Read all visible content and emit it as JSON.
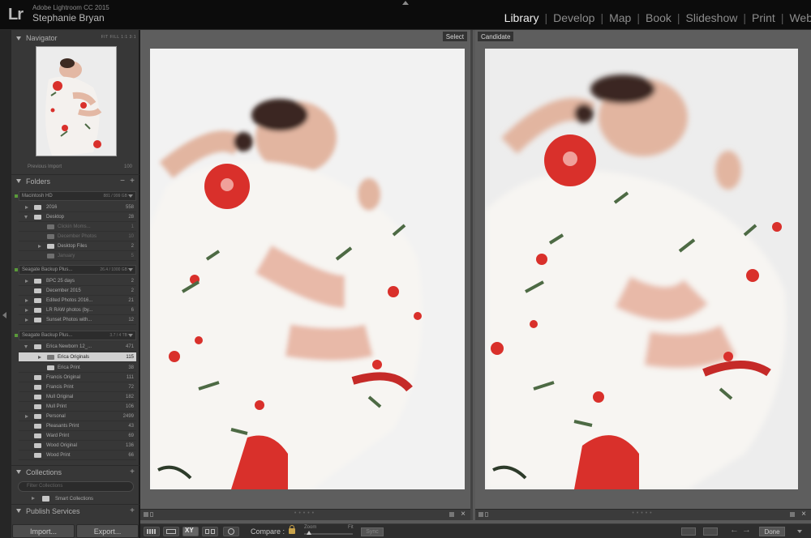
{
  "app": {
    "logo": "Lr",
    "product": "Adobe Lightroom CC 2015",
    "user": "Stephanie Bryan"
  },
  "modules": [
    {
      "label": "Library",
      "active": true
    },
    {
      "label": "Develop",
      "active": false
    },
    {
      "label": "Map",
      "active": false
    },
    {
      "label": "Book",
      "active": false
    },
    {
      "label": "Slideshow",
      "active": false
    },
    {
      "label": "Print",
      "active": false
    },
    {
      "label": "Web",
      "active": false
    }
  ],
  "navigator": {
    "title": "Navigator",
    "zoom_options": "FIT   FILL   1:1   3:1"
  },
  "previous_import": {
    "label": "Previous Import",
    "count": "100"
  },
  "folders": {
    "title": "Folders",
    "volumes": [
      {
        "name": "Macintosh HD",
        "size": "881 / 999 GB"
      },
      {
        "name": "Seagate Backup Plus...",
        "size": "26.4 / 1000 GB"
      },
      {
        "name": "Seagate Backup Plus...",
        "size": "3.7 / 4 TB"
      }
    ],
    "vol1_rows": [
      {
        "label": "2016",
        "count": "558"
      },
      {
        "label": "Desktop",
        "count": "28"
      },
      {
        "label": "Clickin Moms...",
        "count": "1"
      },
      {
        "label": "December Photos",
        "count": "10"
      },
      {
        "label": "Desktop Files",
        "count": "2"
      },
      {
        "label": "January",
        "count": "5"
      }
    ],
    "vol2_rows": [
      {
        "label": "BPC 25 days",
        "count": "2"
      },
      {
        "label": "December 2015",
        "count": "2"
      },
      {
        "label": "Edited Photos 2016...",
        "count": "21"
      },
      {
        "label": "LR RAW photos (by...",
        "count": "6"
      },
      {
        "label": "Sunset Photos with...",
        "count": "12"
      }
    ],
    "vol3_rows": [
      {
        "label": "Erica Newborn 12_...",
        "count": "471"
      },
      {
        "label": "Erica Originals",
        "count": "115"
      },
      {
        "label": "Erica Print",
        "count": "38"
      },
      {
        "label": "Francis Original",
        "count": "111"
      },
      {
        "label": "Francis Print",
        "count": "72"
      },
      {
        "label": "Mull Original",
        "count": "182"
      },
      {
        "label": "Mull Print",
        "count": "106"
      },
      {
        "label": "Personal",
        "count": "2499"
      },
      {
        "label": "Pleasants Print",
        "count": "43"
      },
      {
        "label": "Ward Print",
        "count": "69"
      },
      {
        "label": "Wood Original",
        "count": "136"
      },
      {
        "label": "Wood Print",
        "count": "66"
      }
    ]
  },
  "collections": {
    "title": "Collections",
    "search_placeholder": "Filter Collections",
    "smart_collections": "Smart Collections"
  },
  "publish": {
    "title": "Publish Services"
  },
  "buttons": {
    "import": "Import...",
    "export": "Export..."
  },
  "compare": {
    "select_label": "Select",
    "candidate_label": "Candidate"
  },
  "toolbar": {
    "compare_label": "Compare :",
    "zoom_label": "Zoom",
    "fit_label": "Fit",
    "sync_label": "Sync",
    "done_label": "Done",
    "xy_label": "XY"
  },
  "colors": {
    "accent_lock": "#c9a34a",
    "poppy_red": "#d9302b",
    "leaf_green": "#4d6a44"
  }
}
